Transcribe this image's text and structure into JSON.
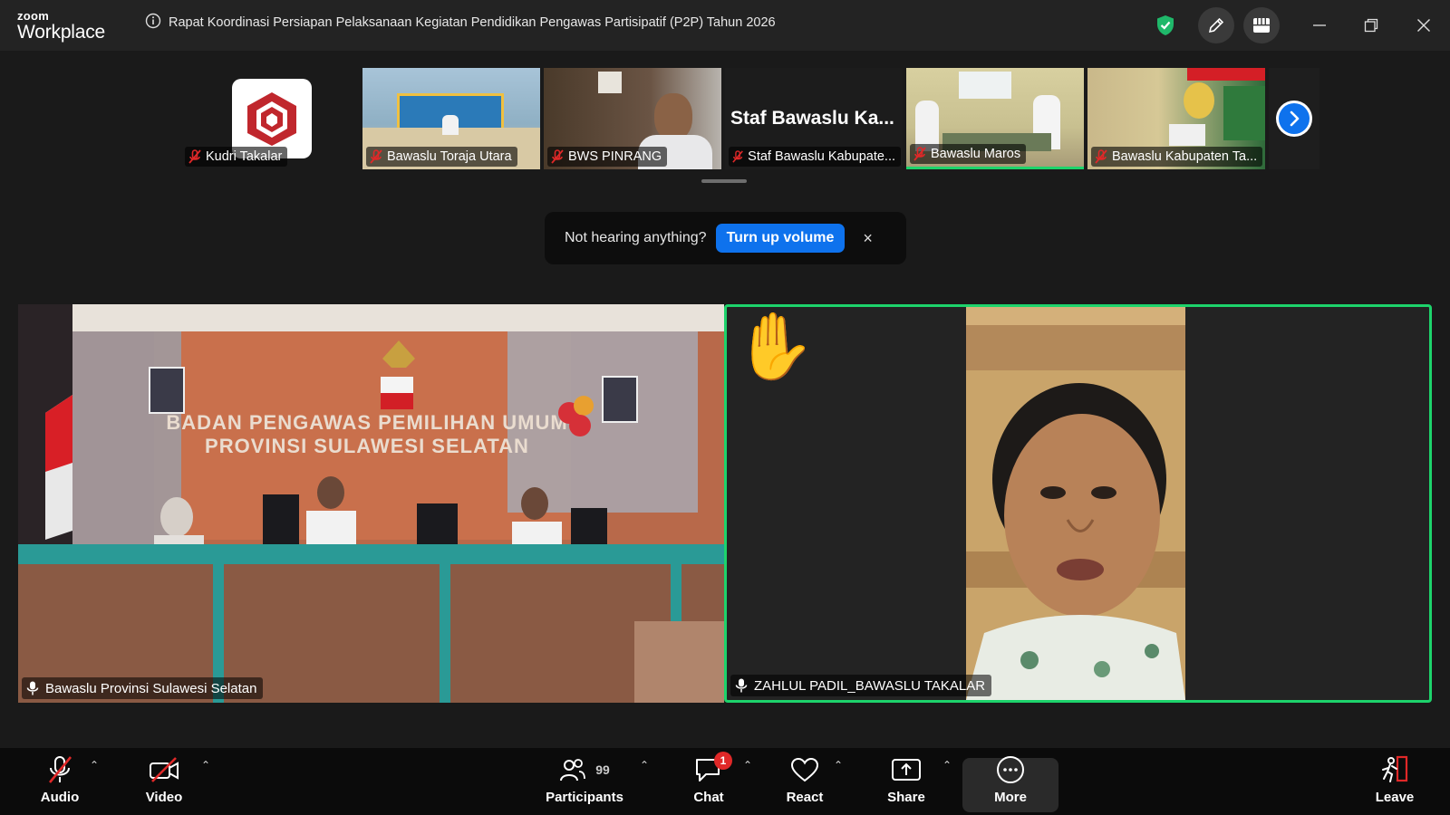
{
  "app": {
    "logo_top": "zoom",
    "logo_bottom": "Workplace"
  },
  "meeting": {
    "title": "Rapat Koordinasi Persiapan Pelaksanaan Kegiatan Pendidikan Pengawas Partisipatif (P2P) Tahun 2026"
  },
  "thumbnails": [
    {
      "name": "Kudri Takalar",
      "muted": true
    },
    {
      "name": "Bawaslu Toraja Utara",
      "muted": true
    },
    {
      "name": "BWS PINRANG",
      "muted": true
    },
    {
      "name": "Staf Bawaslu Kabupate...",
      "big_name": "Staf  Bawaslu  Ka...",
      "muted": true
    },
    {
      "name": "Bawaslu Maros",
      "muted": true
    },
    {
      "name": "Bawaslu Kabupaten Ta...",
      "muted": true
    }
  ],
  "notice": {
    "text": "Not hearing anything?",
    "button": "Turn up volume",
    "close": "×"
  },
  "videos": {
    "left": {
      "name": "Bawaslu Provinsi Sulawesi Selatan",
      "banner_line1": "BADAN PENGAWAS PEMILIHAN UMUM",
      "banner_line2": "PROVINSI SULAWESI SELATAN"
    },
    "right": {
      "name": "ZAHLUL PADIL_BAWASLU TAKALAR",
      "reaction": "✋"
    }
  },
  "toolbar": {
    "audio": "Audio",
    "video": "Video",
    "participants": "Participants",
    "participants_count": "99",
    "chat": "Chat",
    "chat_badge": "1",
    "react": "React",
    "share": "Share",
    "more": "More",
    "leave": "Leave"
  },
  "colors": {
    "accent_blue": "#0e72ed",
    "active_speaker": "#1dd36b",
    "muted_red": "#e02828",
    "security_green": "#1fb86a"
  }
}
